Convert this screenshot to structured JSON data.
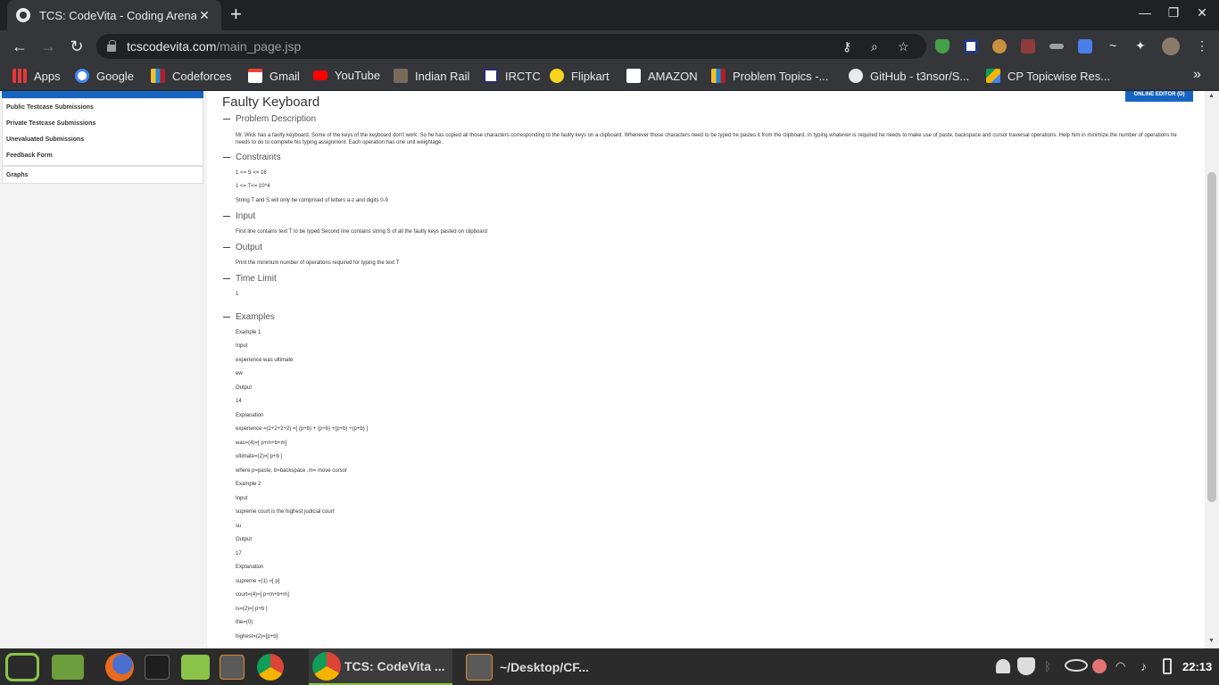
{
  "browser": {
    "tab_title": "TCS: CodeVita - Coding Arena",
    "tab_close": "✕",
    "new_tab": "+",
    "window_controls": [
      "—",
      "❐",
      "✕"
    ],
    "url_host": "tcscodevita.com",
    "url_path": "/main_page.jsp",
    "bookmarks": [
      "Apps",
      "Google",
      "Codeforces",
      "Gmail",
      "YouTube",
      "Indian Rail",
      "IRCTC",
      "Flipkart",
      "AMAZON",
      "Problem Topics -...",
      "GitHub - t3nsor/S...",
      "CP Topicwise Res..."
    ],
    "bookmarks_more": "»"
  },
  "sidebar": {
    "links": [
      "Public Testcase Submissions",
      "Private Testcase Submissions",
      "Unevaluated Submissions",
      "Feedback Form"
    ],
    "graphs": "Graphs"
  },
  "problem": {
    "title": "Faulty Keyboard",
    "online_editor": "ONLINE EDITOR (D)",
    "sections": {
      "description": "Problem Description",
      "constraints": "Constraints",
      "input": "Input",
      "output": "Output",
      "time_limit": "Time Limit",
      "examples": "Examples"
    },
    "description_text": "Mr. Wick has a faulty keyboard. Some of the keys of the keyboard don't work. So he has copied all those characters corresponding to the faulty keys on a clipboard. Whenever those characters need to be typed he pastes it from the clipboard. In typing whatever is required he needs to make use of paste, backspace and cursor traversal operations. Help him in minimize the number of operations he needs to do to complete his typing assignment. Each operation has one unit weightage.",
    "constraints": [
      "1 <= S <= 16",
      "1 <= T<= 10^4",
      "String T and S will only be comprised of letters a-z and digits 0-9"
    ],
    "input_text": "First line contains text T to be typed Second line contains string S of all the faulty keys pasted on clipboard",
    "output_text": "Print the minimum number of operations required for typing the text T",
    "time_limit": "1",
    "examples": [
      "Example 1",
      "Input",
      "experience was ultimate",
      "ew",
      "Output",
      "14",
      "Explanation",
      "experience =(2+2+2+2) =[ (p+b) + (p+b) +(p+b) +(p+b) ]",
      "was=(4)=[ p+m+b+m]",
      "ultimate=(2)=[ p+b ]",
      "where p=paste, b=backspace ,m= move cursor",
      "Example 2",
      "Input",
      "supreme court is the highest judicial court",
      "su",
      "Output",
      "17",
      "Explanation",
      "supreme =(1) =[ p]",
      "court=(4)=[ p+m+b+m]",
      "is=(2)=[ p+b ]",
      "the=(0)",
      "highest=(2)=[p+b]"
    ]
  },
  "taskbar": {
    "tasks": [
      "TCS: CodeVita ...",
      "~/Desktop/CF..."
    ],
    "clock": "22:13"
  }
}
